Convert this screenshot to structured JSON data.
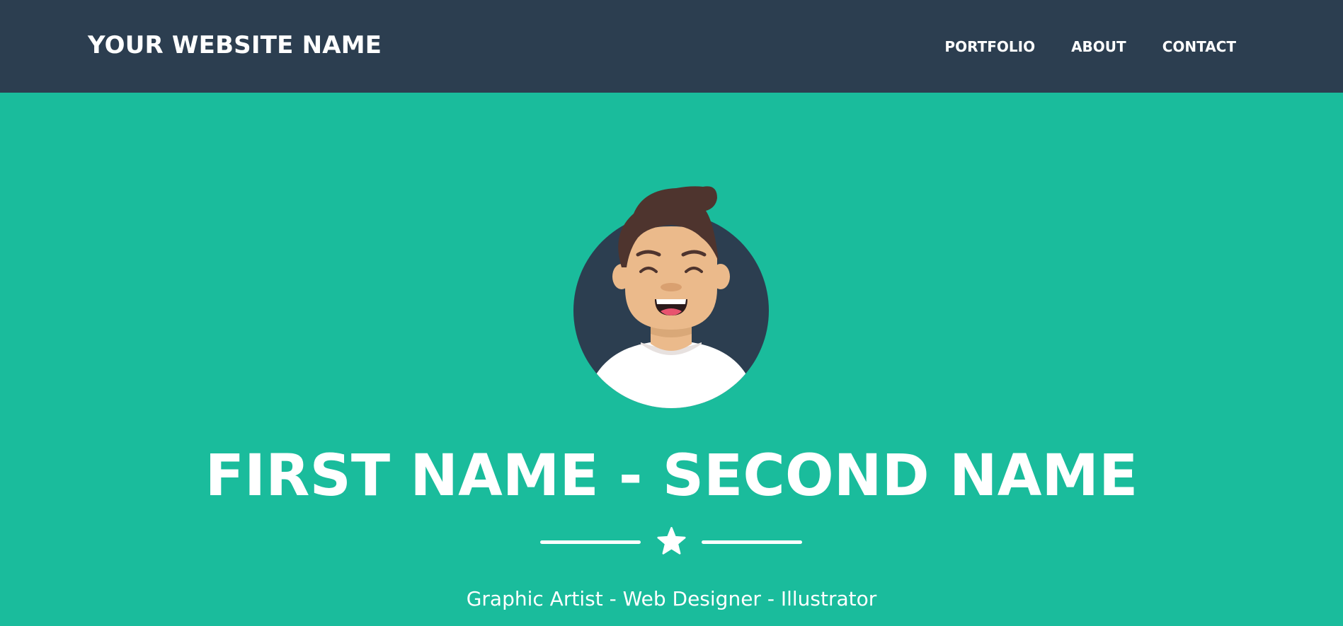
{
  "navbar": {
    "brand": "YOUR WEBSITE NAME",
    "links": [
      {
        "label": "PORTFOLIO"
      },
      {
        "label": "ABOUT"
      },
      {
        "label": "CONTACT"
      }
    ]
  },
  "masthead": {
    "title": "FIRST NAME - SECOND NAME",
    "subtitle": "Graphic Artist - Web Designer - Illustrator",
    "divider_icon": "star-icon",
    "avatar_icon": "avatar-illustration"
  },
  "colors": {
    "navbar_bg": "#2c3e50",
    "hero_bg": "#1abc9c",
    "text": "#ffffff",
    "avatar_circle": "#2c3e50",
    "hair": "#4e342e",
    "skin": "#ebba8b"
  }
}
